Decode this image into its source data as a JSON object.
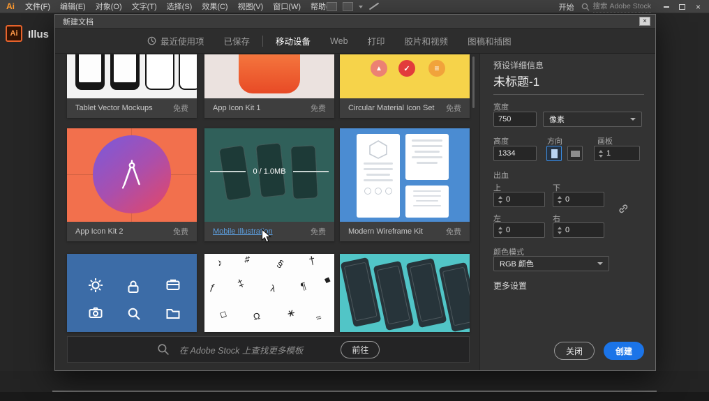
{
  "app": {
    "logo_text": "Ai",
    "menus": [
      "文件(F)",
      "编辑(E)",
      "对象(O)",
      "文字(T)",
      "选择(S)",
      "效果(C)",
      "视图(V)",
      "窗口(W)",
      "帮助(H)"
    ],
    "start_label": "开始",
    "stock_search_label": "搜索 Adobe Stock",
    "window_title_fragment": "Illus",
    "doc_icon_text": "Ai"
  },
  "icons": {
    "close": "×",
    "triangle": "▲",
    "check": "✓",
    "menu": "≡"
  },
  "dialog": {
    "title": "新建文档",
    "tabs": [
      {
        "label": "最近使用项",
        "active": false
      },
      {
        "label": "已保存",
        "active": false
      },
      {
        "label": "移动设备",
        "active": true
      },
      {
        "label": "Web",
        "active": false
      },
      {
        "label": "打印",
        "active": false
      },
      {
        "label": "胶片和视频",
        "active": false
      },
      {
        "label": "图稿和插图",
        "active": false
      }
    ],
    "templates": [
      {
        "name": "Tablet Vector Mockups",
        "price": "免费"
      },
      {
        "name": "App Icon Kit 1",
        "price": "免费"
      },
      {
        "name": "Circular Material Icon Set",
        "price": "免费"
      },
      {
        "name": "App Icon Kit 2",
        "price": "免费"
      },
      {
        "name": "Mobile Illustration",
        "price": "免费",
        "progress": "0 / 1.0MB"
      },
      {
        "name": "Modern Wireframe Kit",
        "price": "免费"
      }
    ],
    "decor_glyphs": [
      "♪",
      "♯",
      "§",
      "†",
      "◆",
      "ƒ",
      "‡",
      "λ",
      "¶",
      "◇",
      "Ω",
      "∗",
      "≈"
    ],
    "stock_bar": {
      "placeholder": "在 Adobe Stock 上查找更多模板",
      "go": "前往"
    },
    "preset": {
      "header": "预设详细信息",
      "doc_name": "未标题-1",
      "width_label": "宽度",
      "width_value": "750",
      "unit_value": "像素",
      "height_label": "高度",
      "height_value": "1334",
      "orientation_label": "方向",
      "artboards_label": "画板",
      "artboards_value": "1",
      "bleed_label": "出血",
      "bleed_top_label": "上",
      "bleed_top_value": "0",
      "bleed_bottom_label": "下",
      "bleed_bottom_value": "0",
      "bleed_left_label": "左",
      "bleed_left_value": "0",
      "bleed_right_label": "右",
      "bleed_right_value": "0",
      "color_mode_label": "颜色模式",
      "color_mode_value": "RGB 颜色",
      "more_settings": "更多设置",
      "close_button": "关闭",
      "create_button": "创建"
    },
    "colors": {
      "accent": "#1b74e8",
      "link": "#5c9fe0"
    }
  }
}
